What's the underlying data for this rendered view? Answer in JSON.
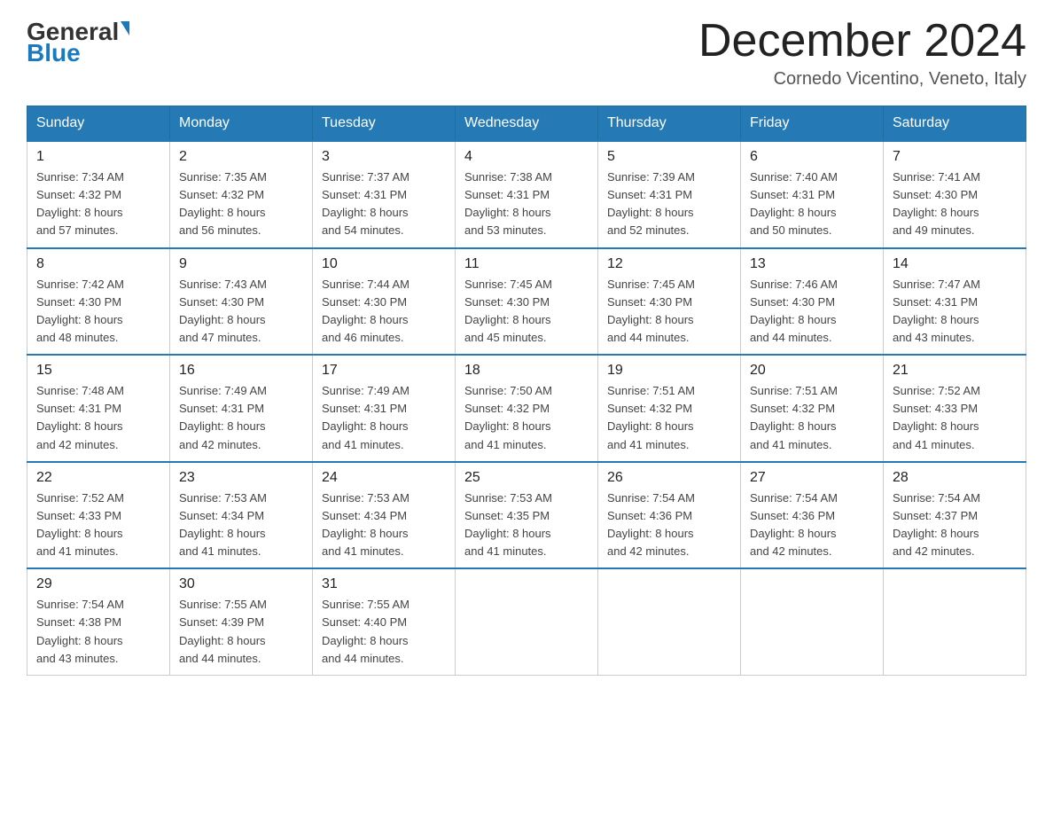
{
  "header": {
    "logo_general": "General",
    "logo_blue": "Blue",
    "month_title": "December 2024",
    "location": "Cornedo Vicentino, Veneto, Italy"
  },
  "days_of_week": [
    "Sunday",
    "Monday",
    "Tuesday",
    "Wednesday",
    "Thursday",
    "Friday",
    "Saturday"
  ],
  "weeks": [
    [
      {
        "day": "1",
        "sunrise": "7:34 AM",
        "sunset": "4:32 PM",
        "daylight": "8 hours and 57 minutes."
      },
      {
        "day": "2",
        "sunrise": "7:35 AM",
        "sunset": "4:32 PM",
        "daylight": "8 hours and 56 minutes."
      },
      {
        "day": "3",
        "sunrise": "7:37 AM",
        "sunset": "4:31 PM",
        "daylight": "8 hours and 54 minutes."
      },
      {
        "day": "4",
        "sunrise": "7:38 AM",
        "sunset": "4:31 PM",
        "daylight": "8 hours and 53 minutes."
      },
      {
        "day": "5",
        "sunrise": "7:39 AM",
        "sunset": "4:31 PM",
        "daylight": "8 hours and 52 minutes."
      },
      {
        "day": "6",
        "sunrise": "7:40 AM",
        "sunset": "4:31 PM",
        "daylight": "8 hours and 50 minutes."
      },
      {
        "day": "7",
        "sunrise": "7:41 AM",
        "sunset": "4:30 PM",
        "daylight": "8 hours and 49 minutes."
      }
    ],
    [
      {
        "day": "8",
        "sunrise": "7:42 AM",
        "sunset": "4:30 PM",
        "daylight": "8 hours and 48 minutes."
      },
      {
        "day": "9",
        "sunrise": "7:43 AM",
        "sunset": "4:30 PM",
        "daylight": "8 hours and 47 minutes."
      },
      {
        "day": "10",
        "sunrise": "7:44 AM",
        "sunset": "4:30 PM",
        "daylight": "8 hours and 46 minutes."
      },
      {
        "day": "11",
        "sunrise": "7:45 AM",
        "sunset": "4:30 PM",
        "daylight": "8 hours and 45 minutes."
      },
      {
        "day": "12",
        "sunrise": "7:45 AM",
        "sunset": "4:30 PM",
        "daylight": "8 hours and 44 minutes."
      },
      {
        "day": "13",
        "sunrise": "7:46 AM",
        "sunset": "4:30 PM",
        "daylight": "8 hours and 44 minutes."
      },
      {
        "day": "14",
        "sunrise": "7:47 AM",
        "sunset": "4:31 PM",
        "daylight": "8 hours and 43 minutes."
      }
    ],
    [
      {
        "day": "15",
        "sunrise": "7:48 AM",
        "sunset": "4:31 PM",
        "daylight": "8 hours and 42 minutes."
      },
      {
        "day": "16",
        "sunrise": "7:49 AM",
        "sunset": "4:31 PM",
        "daylight": "8 hours and 42 minutes."
      },
      {
        "day": "17",
        "sunrise": "7:49 AM",
        "sunset": "4:31 PM",
        "daylight": "8 hours and 41 minutes."
      },
      {
        "day": "18",
        "sunrise": "7:50 AM",
        "sunset": "4:32 PM",
        "daylight": "8 hours and 41 minutes."
      },
      {
        "day": "19",
        "sunrise": "7:51 AM",
        "sunset": "4:32 PM",
        "daylight": "8 hours and 41 minutes."
      },
      {
        "day": "20",
        "sunrise": "7:51 AM",
        "sunset": "4:32 PM",
        "daylight": "8 hours and 41 minutes."
      },
      {
        "day": "21",
        "sunrise": "7:52 AM",
        "sunset": "4:33 PM",
        "daylight": "8 hours and 41 minutes."
      }
    ],
    [
      {
        "day": "22",
        "sunrise": "7:52 AM",
        "sunset": "4:33 PM",
        "daylight": "8 hours and 41 minutes."
      },
      {
        "day": "23",
        "sunrise": "7:53 AM",
        "sunset": "4:34 PM",
        "daylight": "8 hours and 41 minutes."
      },
      {
        "day": "24",
        "sunrise": "7:53 AM",
        "sunset": "4:34 PM",
        "daylight": "8 hours and 41 minutes."
      },
      {
        "day": "25",
        "sunrise": "7:53 AM",
        "sunset": "4:35 PM",
        "daylight": "8 hours and 41 minutes."
      },
      {
        "day": "26",
        "sunrise": "7:54 AM",
        "sunset": "4:36 PM",
        "daylight": "8 hours and 42 minutes."
      },
      {
        "day": "27",
        "sunrise": "7:54 AM",
        "sunset": "4:36 PM",
        "daylight": "8 hours and 42 minutes."
      },
      {
        "day": "28",
        "sunrise": "7:54 AM",
        "sunset": "4:37 PM",
        "daylight": "8 hours and 42 minutes."
      }
    ],
    [
      {
        "day": "29",
        "sunrise": "7:54 AM",
        "sunset": "4:38 PM",
        "daylight": "8 hours and 43 minutes."
      },
      {
        "day": "30",
        "sunrise": "7:55 AM",
        "sunset": "4:39 PM",
        "daylight": "8 hours and 44 minutes."
      },
      {
        "day": "31",
        "sunrise": "7:55 AM",
        "sunset": "4:40 PM",
        "daylight": "8 hours and 44 minutes."
      },
      null,
      null,
      null,
      null
    ]
  ],
  "labels": {
    "sunrise": "Sunrise:",
    "sunset": "Sunset:",
    "daylight": "Daylight:"
  }
}
